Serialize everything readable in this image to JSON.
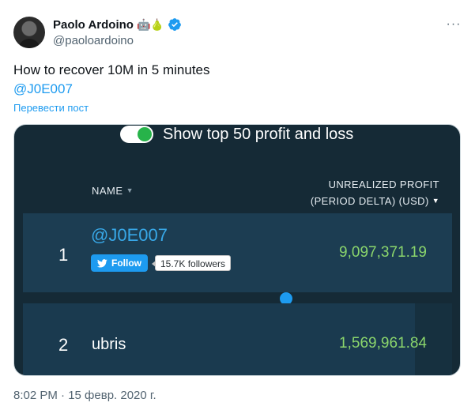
{
  "author": {
    "display_name": "Paolo Ardoino",
    "emojis": "🤖🍐",
    "handle": "@paoloardoino"
  },
  "tweet": {
    "text": "How to recover 10M in 5 minutes",
    "mention": "@J0E007",
    "translate_label": "Перевести пост",
    "timestamp": "8:02 PM · 15 февр. 2020 г."
  },
  "media": {
    "toggle_label": "Show top 50 profit and loss",
    "columns": {
      "name": "NAME",
      "profit_line1": "UNREALIZED PROFIT",
      "profit_line2": "(PERIOD DELTA) (USD)"
    },
    "rows": [
      {
        "rank": "1",
        "user": "@J0E007",
        "follow_label": "Follow",
        "followers": "15.7K followers",
        "profit": "9,097,371.19"
      },
      {
        "rank": "2",
        "user": "ubris",
        "profit": "1,569,961.84"
      }
    ]
  },
  "colors": {
    "accent": "#1d9bf0",
    "profit_green": "#8bd66c",
    "panel_bg": "#152a36"
  }
}
